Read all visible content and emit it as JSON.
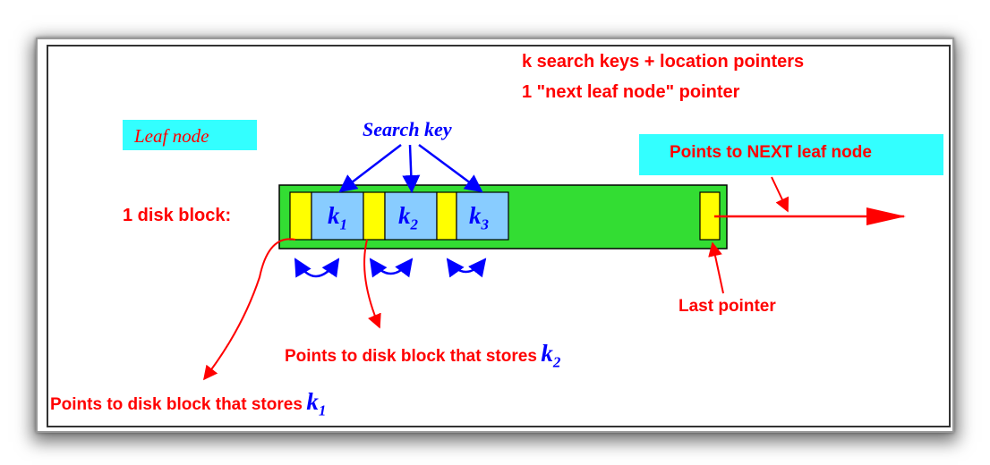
{
  "header": {
    "line1": "k  search keys + location pointers",
    "line2": "1  \"next leaf node\" pointer"
  },
  "leaf_node_label": "Leaf node",
  "search_key_label": "Search key",
  "disk_block_label": "1 disk block:",
  "next_leaf_label": "Points to NEXT leaf node",
  "last_pointer_label": "Last pointer",
  "keys": [
    {
      "letter": "k",
      "sub": "1"
    },
    {
      "letter": "k",
      "sub": "2"
    },
    {
      "letter": "k",
      "sub": "3"
    }
  ],
  "pointer_note_k2": {
    "text": "Points to disk block that stores",
    "letter": "k",
    "sub": "2"
  },
  "pointer_note_k1": {
    "text": "Points to disk block that stores",
    "letter": "k",
    "sub": "1"
  },
  "colors": {
    "red": "#ff0000",
    "blue": "#0000ff",
    "block_green": "#33dd33",
    "key_blue": "#88ccff",
    "pointer_yellow": "#ffff00",
    "cyan": "#33ffff"
  }
}
